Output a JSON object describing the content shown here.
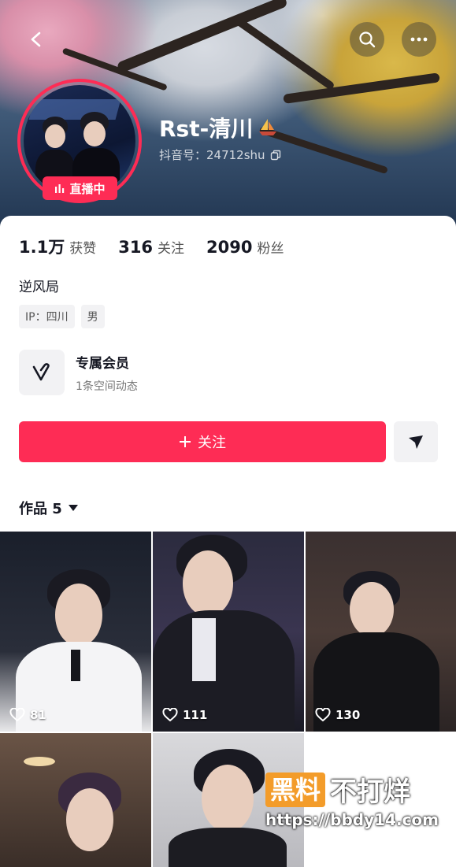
{
  "header": {
    "back_icon": "back-arrow-icon",
    "search_icon": "search-icon",
    "more_icon": "more-icon",
    "live_badge": "直播中",
    "name": "Rst-清川",
    "douyin_id": "抖音号：24712shu"
  },
  "stats": [
    {
      "num": "1.1万",
      "label": "获赞"
    },
    {
      "num": "316",
      "label": "关注"
    },
    {
      "num": "2090",
      "label": "粉丝"
    }
  ],
  "bio": "逆风局",
  "tags": [
    "IP：四川",
    "男"
  ],
  "member": {
    "title": "专属会员",
    "subtitle": "1条空间动态"
  },
  "follow_button": "关注",
  "works": {
    "label": "作品 5"
  },
  "videos": [
    {
      "likes": "81"
    },
    {
      "likes": "111"
    },
    {
      "likes": "130"
    },
    {
      "likes": ""
    },
    {
      "likes": ""
    }
  ],
  "watermark": {
    "box": "黑料",
    "text": "不打烊",
    "url": "https://bbdy14.com"
  },
  "colors": {
    "accent": "#fe2c55",
    "badge_orange": "#f39c2a"
  }
}
